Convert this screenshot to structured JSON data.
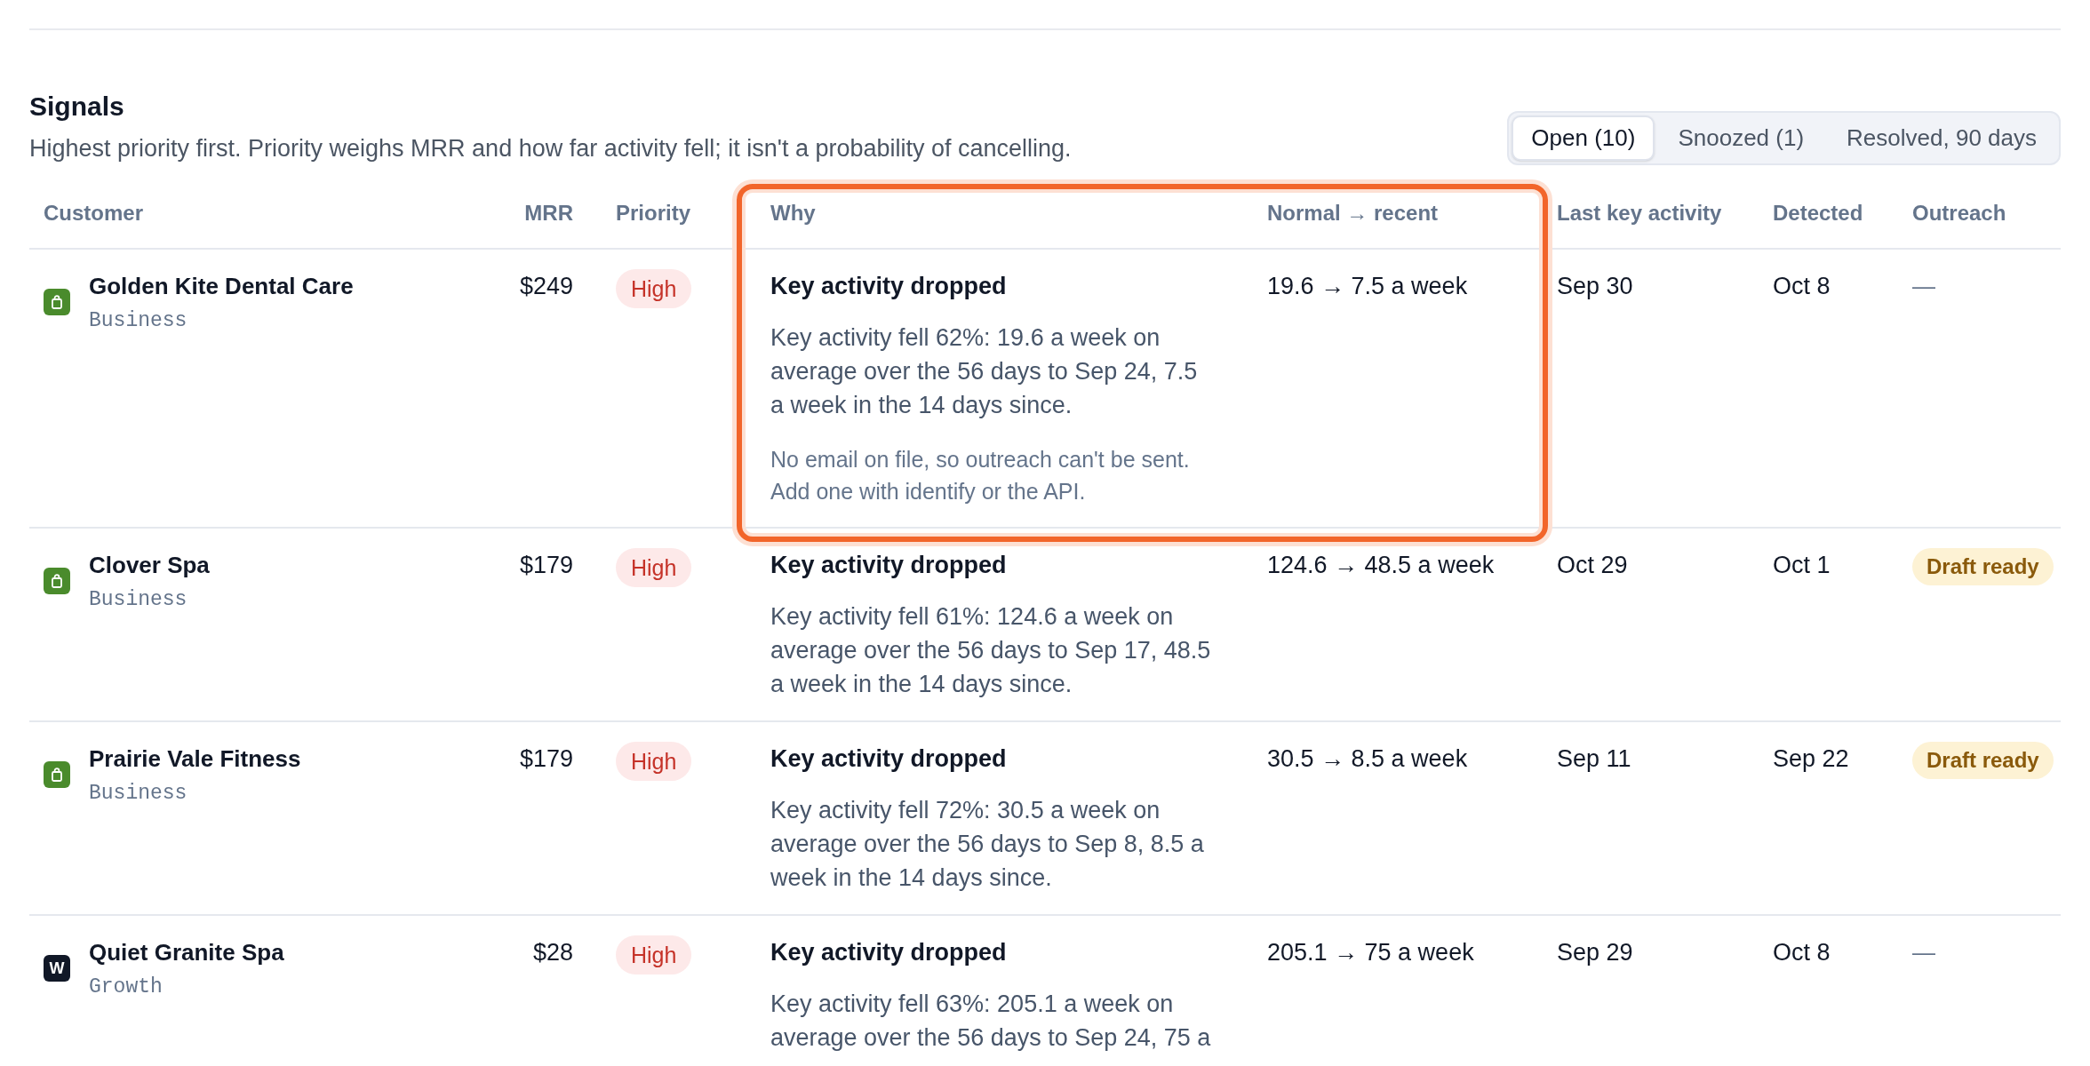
{
  "title": "Signals",
  "subtitle": "Highest priority first. Priority weighs MRR and how far activity fell; it isn't a probability of cancelling.",
  "tabs": [
    {
      "label": "Open (10)",
      "selected": true
    },
    {
      "label": "Snoozed (1)",
      "selected": false
    },
    {
      "label": "Resolved, 90 days",
      "selected": false
    }
  ],
  "table": {
    "columns": [
      {
        "label": "Customer",
        "highlighted": false
      },
      {
        "label": "MRR",
        "highlighted": false
      },
      {
        "label": "Priority",
        "highlighted": false
      },
      {
        "label": "Why",
        "highlighted": true
      },
      {
        "label": "Normal → recent",
        "highlighted": true
      },
      {
        "label": "Last key activity",
        "highlighted": false
      },
      {
        "label": "Detected",
        "highlighted": false
      },
      {
        "label": "Outreach",
        "highlighted": false
      }
    ],
    "rows": [
      {
        "highlighted": true,
        "customer": {
          "name": "Golden Kite Dental Care",
          "plan": "Business",
          "logo": {
            "kind": "bag"
          }
        },
        "mrr": "$249",
        "priority": "High",
        "why": {
          "title": "Key activity dropped",
          "detail": "Key activity fell 62%: 19.6 a week on average over the 56 days to Sep 24, 7.5 a week in the 14 days since.",
          "note": "No email on file, so outreach can't be sent. Add one with identify or the API."
        },
        "change": "19.6 → 7.5 a week",
        "last_key_activity": "Sep 30",
        "detected": "Oct 8",
        "outreach": {
          "kind": "none",
          "text": "—"
        }
      },
      {
        "highlighted": false,
        "customer": {
          "name": "Clover Spa",
          "plan": "Business",
          "logo": {
            "kind": "bag"
          }
        },
        "mrr": "$179",
        "priority": "High",
        "why": {
          "title": "Key activity dropped",
          "detail": "Key activity fell 61%: 124.6 a week on average over the 56 days to Sep 17, 48.5 a week in the 14 days since."
        },
        "change": "124.6 → 48.5 a week",
        "last_key_activity": "Oct 29",
        "detected": "Oct 1",
        "outreach": {
          "kind": "badge",
          "text": "Draft ready"
        }
      },
      {
        "highlighted": false,
        "customer": {
          "name": "Prairie Vale Fitness",
          "plan": "Business",
          "logo": {
            "kind": "bag"
          }
        },
        "mrr": "$179",
        "priority": "High",
        "why": {
          "title": "Key activity dropped",
          "detail": "Key activity fell 72%: 30.5 a week on average over the 56 days to Sep 8, 8.5 a week in the 14 days since."
        },
        "change": "30.5 → 8.5 a week",
        "last_key_activity": "Sep 11",
        "detected": "Sep 22",
        "outreach": {
          "kind": "badge",
          "text": "Draft ready"
        }
      },
      {
        "highlighted": false,
        "customer": {
          "name": "Quiet Granite Spa",
          "plan": "Growth",
          "logo": {
            "kind": "letter",
            "letter": "W"
          }
        },
        "mrr": "$28",
        "priority": "High",
        "why": {
          "title": "Key activity dropped",
          "detail": "Key activity fell 63%: 205.1 a week on average over the 56 days to Sep 24, 75 a"
        },
        "change": "205.1 → 75 a week",
        "last_key_activity": "Sep 29",
        "detected": "Oct 8",
        "outreach": {
          "kind": "none",
          "text": "—"
        }
      }
    ]
  }
}
